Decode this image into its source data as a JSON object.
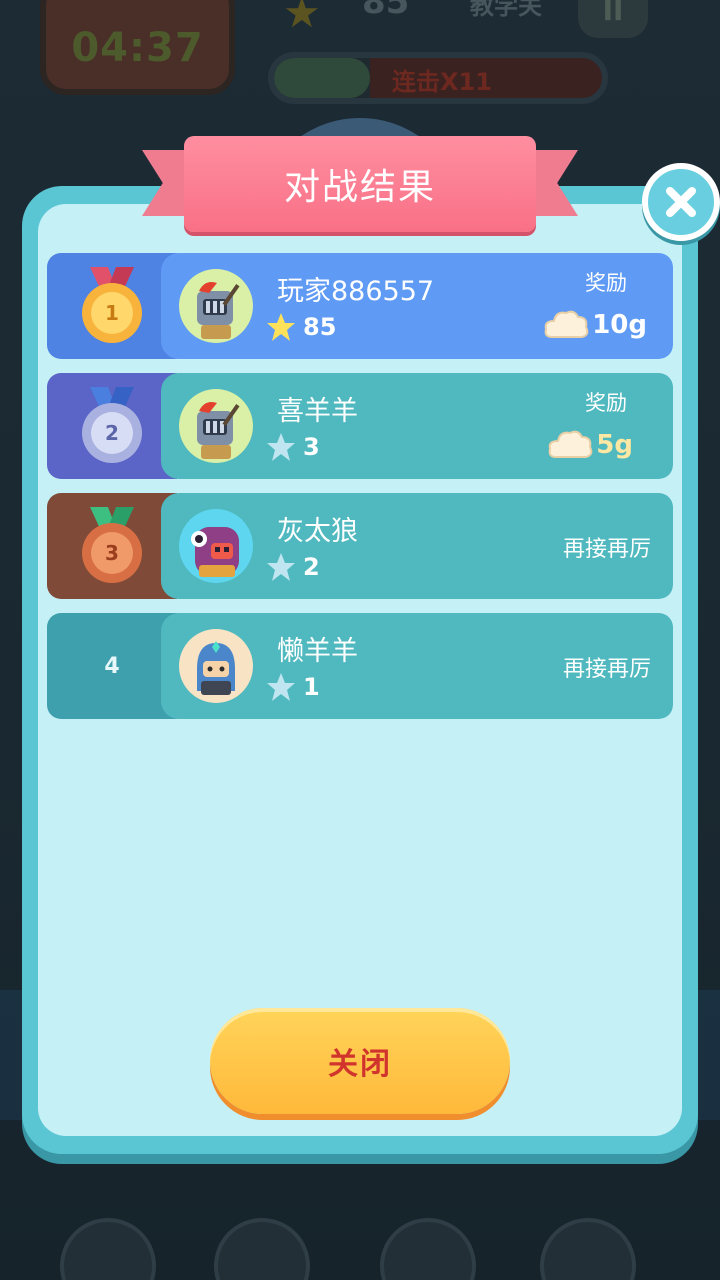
{
  "background": {
    "timer": "04:37",
    "score": "85",
    "tutorial_label": "教学关",
    "pause_icon": "II",
    "combo_label": "连击X11"
  },
  "dialog": {
    "title": "对战结果",
    "close_icon": "close-x-icon",
    "players": [
      {
        "rank": "1",
        "name": "玩家886557",
        "stars": "85",
        "reward_label": "奖励",
        "reward_amount": "10g",
        "medal": "gold",
        "star_color": "#ffe15a"
      },
      {
        "rank": "2",
        "name": "喜羊羊",
        "stars": "3",
        "reward_label": "奖励",
        "reward_amount": "5g",
        "medal": "silver",
        "star_color": "#bfe6f0"
      },
      {
        "rank": "3",
        "name": "灰太狼",
        "stars": "2",
        "encourage": "再接再厉",
        "medal": "bronze",
        "star_color": "#bfe6f0"
      },
      {
        "rank": "4",
        "name": "懒羊羊",
        "stars": "1",
        "encourage": "再接再厉",
        "medal": "none",
        "star_color": "#bfe6f0"
      }
    ],
    "close_button_label": "关闭"
  },
  "colors": {
    "dialog_border": "#5bc6d3",
    "dialog_fill": "#c4f0f6",
    "ribbon": "#f97086",
    "row_first": "#5f9bf4",
    "row_other": "#4fb9bf",
    "button": "#ffc54a",
    "button_text": "#d0342c"
  }
}
